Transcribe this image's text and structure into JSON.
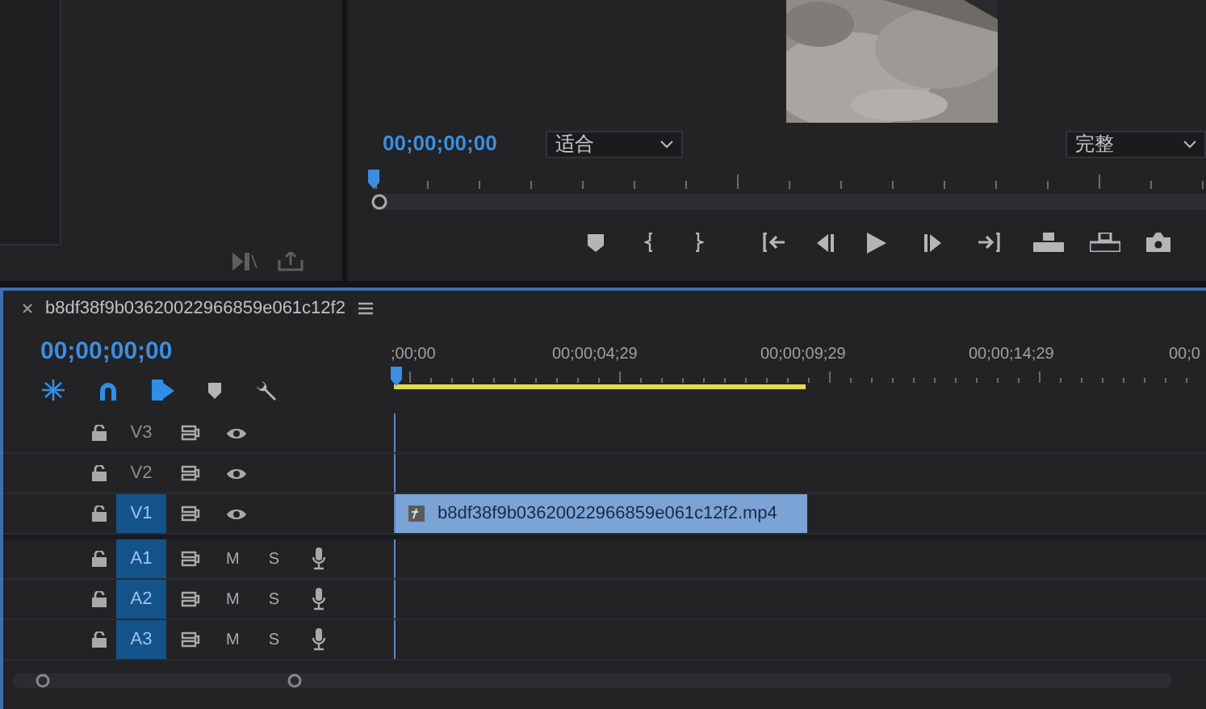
{
  "program_monitor": {
    "timecode": "00;00;00;00",
    "fit_dropdown": "适合",
    "quality_dropdown": "完整"
  },
  "timeline": {
    "title": "b8df38f9b03620022966859e061c12f2",
    "timecode": "00;00;00;00",
    "ruler_labels": [
      ";00;00",
      "00;00;04;29",
      "00;00;09;29",
      "00;00;14;29",
      "00;0"
    ],
    "tracks": [
      {
        "kind": "video",
        "name": "V3",
        "targeted": false
      },
      {
        "kind": "video",
        "name": "V2",
        "targeted": false
      },
      {
        "kind": "video",
        "name": "V1",
        "targeted": true,
        "clip": "b8df38f9b03620022966859e061c12f2.mp4"
      },
      {
        "kind": "audio",
        "name": "A1",
        "targeted": true,
        "mute": "M",
        "solo": "S"
      },
      {
        "kind": "audio",
        "name": "A2",
        "targeted": true,
        "mute": "M",
        "solo": "S"
      },
      {
        "kind": "audio",
        "name": "A3",
        "targeted": true,
        "mute": "M",
        "solo": "S"
      }
    ]
  }
}
